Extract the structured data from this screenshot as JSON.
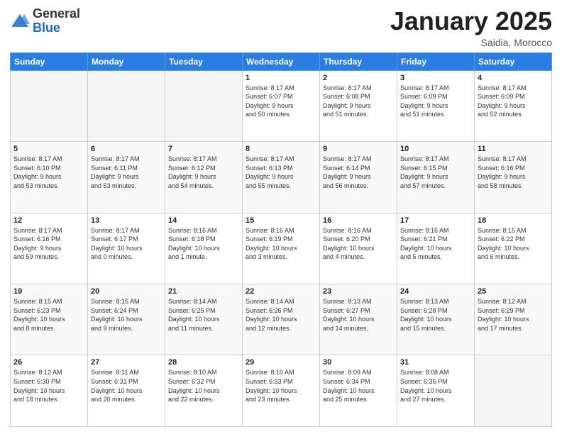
{
  "header": {
    "logo_general": "General",
    "logo_blue": "Blue",
    "title": "January 2025",
    "location": "Saidia, Morocco"
  },
  "days_of_week": [
    "Sunday",
    "Monday",
    "Tuesday",
    "Wednesday",
    "Thursday",
    "Friday",
    "Saturday"
  ],
  "weeks": [
    [
      {
        "day": "",
        "info": ""
      },
      {
        "day": "",
        "info": ""
      },
      {
        "day": "",
        "info": ""
      },
      {
        "day": "1",
        "info": "Sunrise: 8:17 AM\nSunset: 6:07 PM\nDaylight: 9 hours\nand 50 minutes."
      },
      {
        "day": "2",
        "info": "Sunrise: 8:17 AM\nSunset: 6:08 PM\nDaylight: 9 hours\nand 51 minutes."
      },
      {
        "day": "3",
        "info": "Sunrise: 8:17 AM\nSunset: 6:09 PM\nDaylight: 9 hours\nand 51 minutes."
      },
      {
        "day": "4",
        "info": "Sunrise: 8:17 AM\nSunset: 6:09 PM\nDaylight: 9 hours\nand 52 minutes."
      }
    ],
    [
      {
        "day": "5",
        "info": "Sunrise: 8:17 AM\nSunset: 6:10 PM\nDaylight: 9 hours\nand 53 minutes."
      },
      {
        "day": "6",
        "info": "Sunrise: 8:17 AM\nSunset: 6:11 PM\nDaylight: 9 hours\nand 53 minutes."
      },
      {
        "day": "7",
        "info": "Sunrise: 8:17 AM\nSunset: 6:12 PM\nDaylight: 9 hours\nand 54 minutes."
      },
      {
        "day": "8",
        "info": "Sunrise: 8:17 AM\nSunset: 6:13 PM\nDaylight: 9 hours\nand 55 minutes."
      },
      {
        "day": "9",
        "info": "Sunrise: 8:17 AM\nSunset: 6:14 PM\nDaylight: 9 hours\nand 56 minutes."
      },
      {
        "day": "10",
        "info": "Sunrise: 8:17 AM\nSunset: 6:15 PM\nDaylight: 9 hours\nand 57 minutes."
      },
      {
        "day": "11",
        "info": "Sunrise: 8:17 AM\nSunset: 6:16 PM\nDaylight: 9 hours\nand 58 minutes."
      }
    ],
    [
      {
        "day": "12",
        "info": "Sunrise: 8:17 AM\nSunset: 6:16 PM\nDaylight: 9 hours\nand 59 minutes."
      },
      {
        "day": "13",
        "info": "Sunrise: 8:17 AM\nSunset: 6:17 PM\nDaylight: 10 hours\nand 0 minutes."
      },
      {
        "day": "14",
        "info": "Sunrise: 8:16 AM\nSunset: 6:18 PM\nDaylight: 10 hours\nand 1 minute."
      },
      {
        "day": "15",
        "info": "Sunrise: 8:16 AM\nSunset: 6:19 PM\nDaylight: 10 hours\nand 3 minutes."
      },
      {
        "day": "16",
        "info": "Sunrise: 8:16 AM\nSunset: 6:20 PM\nDaylight: 10 hours\nand 4 minutes."
      },
      {
        "day": "17",
        "info": "Sunrise: 8:16 AM\nSunset: 6:21 PM\nDaylight: 10 hours\nand 5 minutes."
      },
      {
        "day": "18",
        "info": "Sunrise: 8:15 AM\nSunset: 6:22 PM\nDaylight: 10 hours\nand 6 minutes."
      }
    ],
    [
      {
        "day": "19",
        "info": "Sunrise: 8:15 AM\nSunset: 6:23 PM\nDaylight: 10 hours\nand 8 minutes."
      },
      {
        "day": "20",
        "info": "Sunrise: 8:15 AM\nSunset: 6:24 PM\nDaylight: 10 hours\nand 9 minutes."
      },
      {
        "day": "21",
        "info": "Sunrise: 8:14 AM\nSunset: 6:25 PM\nDaylight: 10 hours\nand 11 minutes."
      },
      {
        "day": "22",
        "info": "Sunrise: 8:14 AM\nSunset: 6:26 PM\nDaylight: 10 hours\nand 12 minutes."
      },
      {
        "day": "23",
        "info": "Sunrise: 8:13 AM\nSunset: 6:27 PM\nDaylight: 10 hours\nand 14 minutes."
      },
      {
        "day": "24",
        "info": "Sunrise: 8:13 AM\nSunset: 6:28 PM\nDaylight: 10 hours\nand 15 minutes."
      },
      {
        "day": "25",
        "info": "Sunrise: 8:12 AM\nSunset: 6:29 PM\nDaylight: 10 hours\nand 17 minutes."
      }
    ],
    [
      {
        "day": "26",
        "info": "Sunrise: 8:12 AM\nSunset: 6:30 PM\nDaylight: 10 hours\nand 18 minutes."
      },
      {
        "day": "27",
        "info": "Sunrise: 8:11 AM\nSunset: 6:31 PM\nDaylight: 10 hours\nand 20 minutes."
      },
      {
        "day": "28",
        "info": "Sunrise: 8:10 AM\nSunset: 6:32 PM\nDaylight: 10 hours\nand 22 minutes."
      },
      {
        "day": "29",
        "info": "Sunrise: 8:10 AM\nSunset: 6:33 PM\nDaylight: 10 hours\nand 23 minutes."
      },
      {
        "day": "30",
        "info": "Sunrise: 8:09 AM\nSunset: 6:34 PM\nDaylight: 10 hours\nand 25 minutes."
      },
      {
        "day": "31",
        "info": "Sunrise: 8:08 AM\nSunset: 6:35 PM\nDaylight: 10 hours\nand 27 minutes."
      },
      {
        "day": "",
        "info": ""
      }
    ]
  ]
}
